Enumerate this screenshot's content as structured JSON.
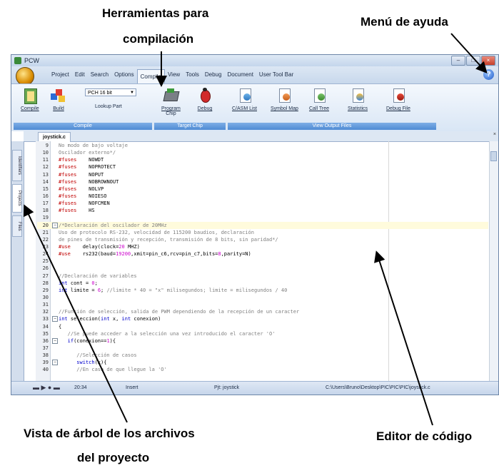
{
  "annotations": {
    "toolbar_title_line1": "Herramientas para",
    "toolbar_title_line2": "compilación",
    "help_menu": "Menú de ayuda",
    "tree_view_line1": "Vista de árbol de los archivos",
    "tree_view_line2": "del proyecto",
    "code_editor": "Editor de código"
  },
  "window": {
    "title": "PCW",
    "minimize": "–",
    "maximize": "□",
    "close": "×",
    "help_icon": "?"
  },
  "menu": {
    "items": [
      "Project",
      "Edit",
      "Search",
      "Options",
      "Compile",
      "View",
      "Tools",
      "Debug",
      "Document",
      "User Tool Bar"
    ],
    "active": "Compile"
  },
  "ribbon": {
    "compile_group": {
      "label": "Compile",
      "compile_button": "Compile",
      "build_button": "Build",
      "device_select": "PCH 16 bit",
      "lookup_part": "Lookup Part"
    },
    "target_group": {
      "label": "Target Chip",
      "program_chip_line1": "Program",
      "program_chip_line2": "Chip",
      "debug_button": "Debug"
    },
    "output_group": {
      "label": "View Output Files",
      "buttons": [
        "C/ASM List",
        "Symbol Map",
        "Call Tree",
        "Statistics",
        "Debug File"
      ]
    }
  },
  "editor": {
    "file_tab": "joystick.c",
    "side_tabs": [
      "Identifiers",
      "Projects",
      "Files"
    ],
    "lines": [
      {
        "n": "9",
        "t": "No modo de bajo voltaje",
        "c": "comment"
      },
      {
        "n": "10",
        "t": "Oscilador externo*/",
        "c": "comment"
      },
      {
        "n": "11",
        "t": "#fuses    NOWDT",
        "c": "fuse"
      },
      {
        "n": "12",
        "t": "#fuses    NOPROTECT",
        "c": "fuse"
      },
      {
        "n": "13",
        "t": "#fuses    NOPUT",
        "c": "fuse"
      },
      {
        "n": "14",
        "t": "#fuses    NOBROWNOUT",
        "c": "fuse"
      },
      {
        "n": "15",
        "t": "#fuses    NOLVP",
        "c": "fuse"
      },
      {
        "n": "16",
        "t": "#fuses    NOIESO",
        "c": "fuse"
      },
      {
        "n": "17",
        "t": "#fuses    NOFCMEN",
        "c": "fuse"
      },
      {
        "n": "18",
        "t": "#fuses    HS",
        "c": "fuse"
      },
      {
        "n": "19",
        "t": "",
        "c": "plain"
      },
      {
        "n": "20",
        "t": "/*Declaración del oscilador de 20MHz",
        "c": "comment",
        "fold": "−",
        "hl": true
      },
      {
        "n": "21",
        "t": "Uso de protocolo RS-232, velocidad de 115200 baudios, declaración",
        "c": "comment"
      },
      {
        "n": "22",
        "t": "de pines de transmisión y recepción, transmisión de 8 bits, sin paridad*/",
        "c": "comment"
      },
      {
        "n": "23",
        "t": "#use    delay(clock=20 MHZ)",
        "c": "fuse"
      },
      {
        "n": "24",
        "t": "#use    rs232(baud=19200,xmit=pin_c6,rcv=pin_c7,bits=8,parity=N)",
        "c": "fuse"
      },
      {
        "n": "25",
        "t": "",
        "c": "plain"
      },
      {
        "n": "26",
        "t": "",
        "c": "plain"
      },
      {
        "n": "27",
        "t": "//Declaración de variables",
        "c": "comment"
      },
      {
        "n": "28",
        "t": "int cont = 0;",
        "c": "code"
      },
      {
        "n": "29",
        "t": "int limite = 6; //limite * 40 = \"x\" milisegundos; limite = milisegundos / 40",
        "c": "code"
      },
      {
        "n": "30",
        "t": "",
        "c": "plain"
      },
      {
        "n": "31",
        "t": "",
        "c": "plain"
      },
      {
        "n": "32",
        "t": "//Función de selección, salida de PWM dependiendo de la recepción de un caracter",
        "c": "comment"
      },
      {
        "n": "33",
        "t": "int seleccion(int x, int conexion)",
        "c": "code",
        "fold": "−"
      },
      {
        "n": "34",
        "t": "{",
        "c": "code"
      },
      {
        "n": "35",
        "t": "   //Se puede acceder a la selección una vez introducido el caracter 'O'",
        "c": "comment"
      },
      {
        "n": "36",
        "t": "   if(conexion==1){",
        "c": "code",
        "fold": "−"
      },
      {
        "n": "37",
        "t": "",
        "c": "plain"
      },
      {
        "n": "38",
        "t": "      //Selección de casos",
        "c": "comment"
      },
      {
        "n": "39",
        "t": "      switch(x){",
        "c": "code",
        "fold": "−"
      },
      {
        "n": "40",
        "t": "      //En caso de que llegue la 'O'",
        "c": "comment"
      }
    ]
  },
  "status": {
    "time": "20:34",
    "mode": "Insert",
    "project": "Pjt: joystick",
    "path": "C:\\Users\\Bruno\\Desktop\\PIC\\PIC\\PIC\\joystick.c"
  },
  "colors": {
    "comment": "#808080",
    "keyword": "#0000cc",
    "directive": "#c00000",
    "number": "#cc00cc",
    "highlight_line": "#fffbdc",
    "ribbon_group_footer": "#4f8bd4"
  }
}
